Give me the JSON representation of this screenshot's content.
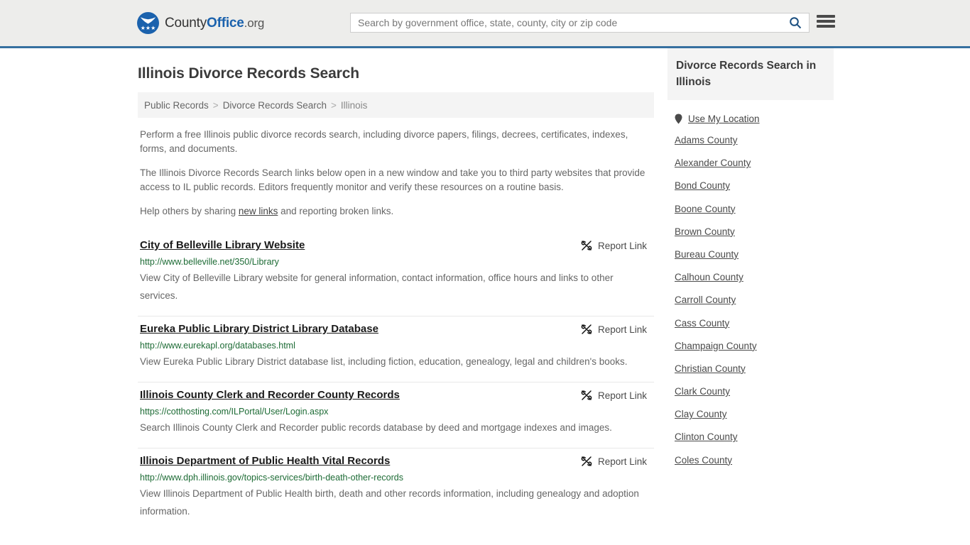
{
  "header": {
    "logo": {
      "text_a": "County",
      "text_b": "Office",
      "text_c": ".org"
    },
    "search": {
      "placeholder": "Search by government office, state, county, city or zip code",
      "value": ""
    }
  },
  "page": {
    "title": "Illinois Divorce Records Search"
  },
  "breadcrumb": {
    "item1": "Public Records",
    "sep1": ">",
    "item2": "Divorce Records Search",
    "sep2": ">",
    "item3": "Illinois"
  },
  "intro": {
    "p1": "Perform a free Illinois public divorce records search, including divorce papers, filings, decrees, certificates, indexes, forms, and documents.",
    "p2": "The Illinois Divorce Records Search links below open in a new window and take you to third party websites that provide access to IL public records. Editors frequently monitor and verify these resources on a routine basis.",
    "p3_before": "Help others by sharing ",
    "p3_link": "new links",
    "p3_after": " and reporting broken links."
  },
  "results": {
    "report_label": "Report Link",
    "items": [
      {
        "title": "City of Belleville Library Website",
        "url": "http://www.belleville.net/350/Library",
        "description": "View City of Belleville Library website for general information, contact information, office hours and links to other services."
      },
      {
        "title": "Eureka Public Library District Library Database",
        "url": "http://www.eurekapl.org/databases.html",
        "description": "View Eureka Public Library District database list, including fiction, education, genealogy, legal and children's books."
      },
      {
        "title": "Illinois County Clerk and Recorder County Records",
        "url": "https://cotthosting.com/ILPortal/User/Login.aspx",
        "description": "Search Illinois County Clerk and Recorder public records database by deed and mortgage indexes and images."
      },
      {
        "title": "Illinois Department of Public Health Vital Records",
        "url": "http://www.dph.illinois.gov/topics-services/birth-death-other-records",
        "description": "View Illinois Department of Public Health birth, death and other records information, including genealogy and adoption information."
      }
    ]
  },
  "sidebar": {
    "heading": "Divorce Records Search in Illinois",
    "use_my_location": "Use My Location",
    "counties": [
      "Adams County",
      "Alexander County",
      "Bond County",
      "Boone County",
      "Brown County",
      "Bureau County",
      "Calhoun County",
      "Carroll County",
      "Cass County",
      "Champaign County",
      "Christian County",
      "Clark County",
      "Clay County",
      "Clinton County",
      "Coles County"
    ]
  },
  "colors": {
    "brand_blue": "#1b62ad",
    "header_bg": "#ededeb",
    "header_border": "#36709f",
    "url_green": "#1d6b35",
    "panel_gray": "#f4f4f4"
  }
}
